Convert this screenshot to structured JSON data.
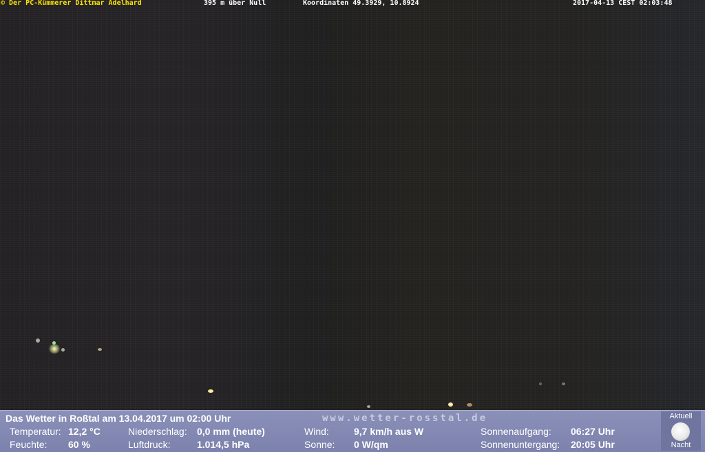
{
  "overlay": {
    "copyright": "© Der PC-Kümmerer Dittmar Adelhard",
    "altitude": "395 m über Null",
    "coordinates": "Koordinaten 49.3929, 10.8924",
    "timestamp": "2017-04-13 CEST 02:03:48"
  },
  "weather": {
    "headline": "Das Wetter in Roßtal am 13.04.2017 um 02:00 Uhr",
    "site": "www.wetter-rosstal.de",
    "temperature": {
      "label": "Temperatur:",
      "value": "12,2 °C"
    },
    "humidity": {
      "label": "Feuchte:",
      "value": "60 %"
    },
    "precipitation": {
      "label": "Niederschlag:",
      "value": "0,0 mm (heute)"
    },
    "pressure": {
      "label": "Luftdruck:",
      "value": "1.014,5 hPa"
    },
    "wind": {
      "label": "Wind:",
      "value": "9,7 km/h aus W"
    },
    "sun": {
      "label": "Sonne:",
      "value": "0 W/qm"
    },
    "sunrise": {
      "label": "Sonnenaufgang:",
      "value": "06:27 Uhr"
    },
    "sunset": {
      "label": "Sonnenuntergang:",
      "value": "20:05 Uhr"
    }
  },
  "moon": {
    "top_label": "Aktuell",
    "bottom_label": "Nacht",
    "icon": "full-moon-icon"
  },
  "colors": {
    "overlay_yellow": "#ffe600",
    "panel": "#8087b2"
  }
}
